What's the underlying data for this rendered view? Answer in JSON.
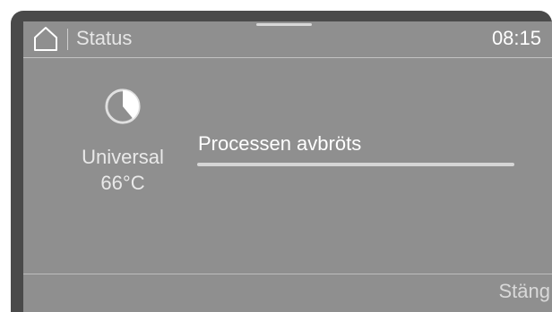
{
  "header": {
    "home_icon": "home-icon",
    "title": "Status",
    "time": "08:15"
  },
  "program": {
    "icon": "program-pie-icon",
    "name": "Universal",
    "temperature": "66°C"
  },
  "status": {
    "message": "Processen avbröts"
  },
  "footer": {
    "close_label": "Stäng"
  },
  "colors": {
    "bezel": "#4a4a4a",
    "screen": "#8f8f8f",
    "text": "#ffffff"
  }
}
